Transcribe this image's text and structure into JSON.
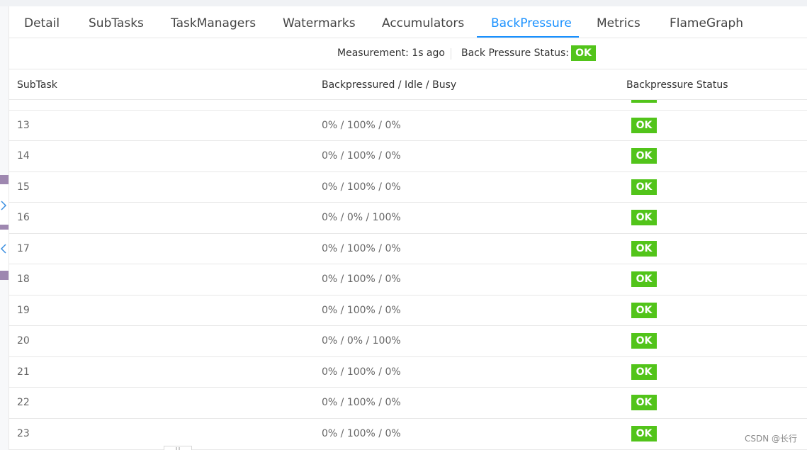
{
  "tabs": [
    {
      "label": "Detail"
    },
    {
      "label": "SubTasks"
    },
    {
      "label": "TaskManagers"
    },
    {
      "label": "Watermarks"
    },
    {
      "label": "Accumulators"
    },
    {
      "label": "BackPressure"
    },
    {
      "label": "Metrics"
    },
    {
      "label": "FlameGraph"
    }
  ],
  "active_tab": "BackPressure",
  "status": {
    "measurement": "Measurement: 1s ago",
    "label": "Back Pressure Status:",
    "value": "OK"
  },
  "table": {
    "columns": [
      "SubTask",
      "Backpressured / Idle / Busy",
      "Backpressure Status"
    ],
    "rows": [
      {
        "subtask": "13",
        "ratio": "0% / 100% / 0%",
        "status": "OK"
      },
      {
        "subtask": "14",
        "ratio": "0% / 100% / 0%",
        "status": "OK"
      },
      {
        "subtask": "15",
        "ratio": "0% / 100% / 0%",
        "status": "OK"
      },
      {
        "subtask": "16",
        "ratio": "0% / 0% / 100%",
        "status": "OK"
      },
      {
        "subtask": "17",
        "ratio": "0% / 100% / 0%",
        "status": "OK"
      },
      {
        "subtask": "18",
        "ratio": "0% / 100% / 0%",
        "status": "OK"
      },
      {
        "subtask": "19",
        "ratio": "0% / 100% / 0%",
        "status": "OK"
      },
      {
        "subtask": "20",
        "ratio": "0% / 0% / 100%",
        "status": "OK"
      },
      {
        "subtask": "21",
        "ratio": "0% / 100% / 0%",
        "status": "OK"
      },
      {
        "subtask": "22",
        "ratio": "0% / 100% / 0%",
        "status": "OK"
      },
      {
        "subtask": "23",
        "ratio": "0% / 100% / 0%",
        "status": "OK"
      }
    ]
  },
  "side_controls": {
    "expand_icon": "chevron-right-icon",
    "collapse_icon": "chevron-left-icon"
  },
  "watermark": "CSDN @长行",
  "colors": {
    "accent": "#1890ff",
    "ok_green": "#52c41a",
    "border": "#e8e8e8",
    "side_bar": "#9e87b0"
  }
}
